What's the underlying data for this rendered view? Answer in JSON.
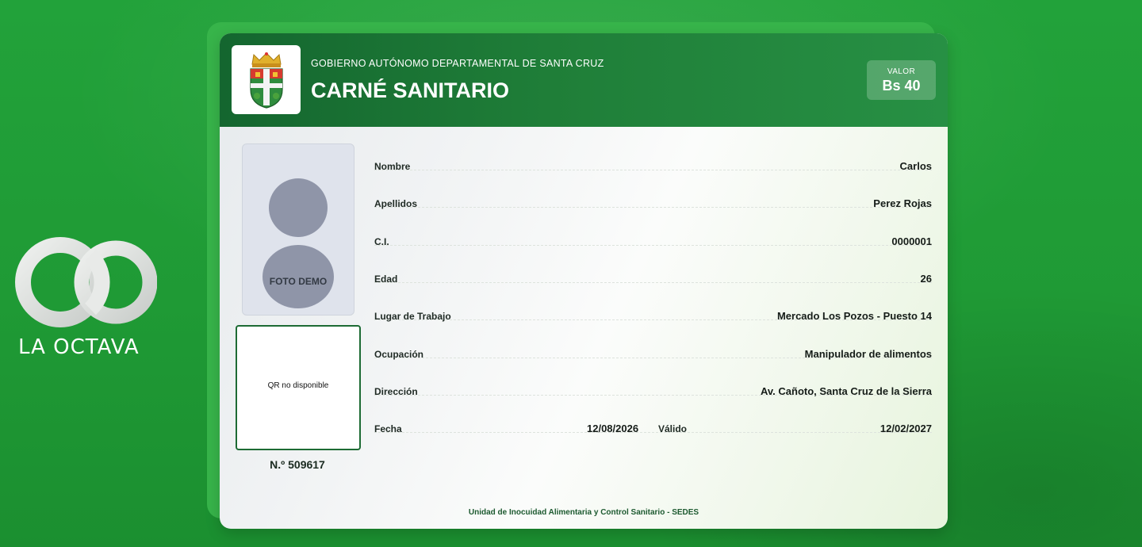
{
  "brand": {
    "logo_text": "LA OCTAVA",
    "ring_color": "#d9dcd9"
  },
  "card": {
    "subtitle": "GOBIERNO AUTÓNOMO DEPARTAMENTAL DE SANTA CRUZ",
    "title": "CARNÉ SANITARIO",
    "value_label": "VALOR",
    "value_amount": "Bs 40",
    "photo_label": "FOTO DEMO",
    "qr_text": "QR no disponible",
    "number": "N.º 509617",
    "footer": "Unidad de Inocuidad Alimentaria y Control Sanitario - SEDES",
    "fields": [
      {
        "label": "Nombre",
        "value": "Carlos"
      },
      {
        "label": "Apellidos",
        "value": "Perez Rojas"
      },
      {
        "label": "C.I.",
        "value": "0000001"
      },
      {
        "label": "Edad",
        "value": "26"
      },
      {
        "label": "Lugar de Trabajo",
        "value": "Mercado Los Pozos - Puesto 14"
      },
      {
        "label": "Ocupación",
        "value": "Manipulador de alimentos"
      },
      {
        "label": "Dirección",
        "value": "Av. Cañoto, Santa Cruz de la Sierra"
      }
    ],
    "dates": {
      "fecha_label": "Fecha",
      "fecha_value": "12/08/2026",
      "valido_label": "Válido",
      "valido_value": "12/02/2027"
    },
    "colors": {
      "header_dark": "#14662f",
      "header_light": "#279044",
      "background_green": "#22a23a",
      "frame_green": "#37b44a"
    }
  }
}
